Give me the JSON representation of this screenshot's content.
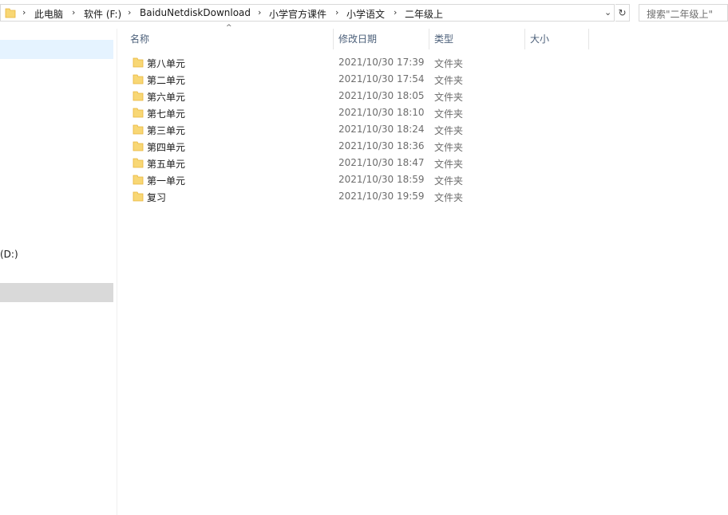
{
  "address_bar": {
    "crumbs": [
      "此电脑",
      "软件 (F:)",
      "BaiduNetdiskDownload",
      "小学官方课件",
      "小学语文",
      "二年级上"
    ]
  },
  "search": {
    "placeholder": "搜索\"二年级上\""
  },
  "nav": {
    "drive_label": "(D:)"
  },
  "columns": {
    "name": "名称",
    "date": "修改日期",
    "type": "类型",
    "size": "大小"
  },
  "files": [
    {
      "name": "第八单元",
      "date": "2021/10/30 17:39",
      "type": "文件夹"
    },
    {
      "name": "第二单元",
      "date": "2021/10/30 17:54",
      "type": "文件夹"
    },
    {
      "name": "第六单元",
      "date": "2021/10/30 18:05",
      "type": "文件夹"
    },
    {
      "name": "第七单元",
      "date": "2021/10/30 18:10",
      "type": "文件夹"
    },
    {
      "name": "第三单元",
      "date": "2021/10/30 18:24",
      "type": "文件夹"
    },
    {
      "name": "第四单元",
      "date": "2021/10/30 18:36",
      "type": "文件夹"
    },
    {
      "name": "第五单元",
      "date": "2021/10/30 18:47",
      "type": "文件夹"
    },
    {
      "name": "第一单元",
      "date": "2021/10/30 18:59",
      "type": "文件夹"
    },
    {
      "name": "复习",
      "date": "2021/10/30 19:59",
      "type": "文件夹"
    }
  ],
  "icons": {
    "folder": "folder-icon",
    "chevron": "chevron-right-icon",
    "refresh": "refresh-icon",
    "dropdown": "chevron-down-icon"
  },
  "colors": {
    "folder": "#f8d775",
    "folder_dark": "#e8b53a",
    "nav_selected": "#e5f3ff",
    "nav_hover": "#d9d9d9",
    "header_text": "#4c607a"
  }
}
